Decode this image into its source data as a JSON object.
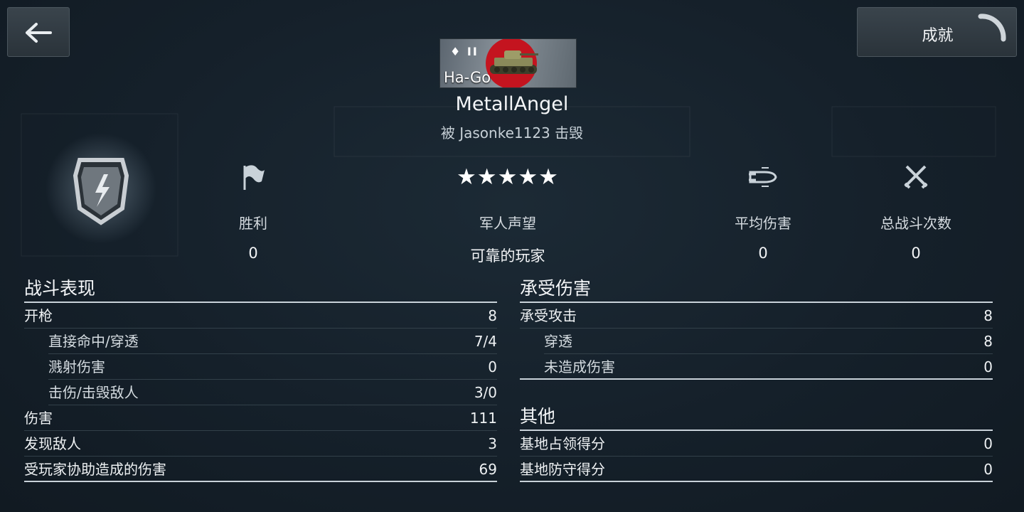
{
  "nav": {
    "back_icon": "arrow-left-icon",
    "achievements_label": "成就",
    "loading_icon": "spinner-icon"
  },
  "vehicle": {
    "tier": "♦ II",
    "name": "Ha-Go",
    "nation_color": "#c4141f"
  },
  "player": {
    "name": "MetallAngel",
    "killed_by": "被 Jasonke1123 击毁"
  },
  "stats": [
    {
      "icon": "flag-icon",
      "label": "胜利",
      "value": "0"
    },
    {
      "icon": "stars-icon",
      "stars": "★★★★★",
      "label": "军人声望",
      "value": "可靠的玩家"
    },
    {
      "icon": "shell-icon",
      "label": "平均伤害",
      "value": "0"
    },
    {
      "icon": "crossed-swords-icon",
      "label": "总战斗次数",
      "value": "0"
    }
  ],
  "combat": {
    "title": "战斗表现",
    "rows": [
      {
        "label": "开枪",
        "value": "8"
      },
      {
        "label": "直接命中/穿透",
        "value": "7/4"
      },
      {
        "label": "溅射伤害",
        "value": "0"
      },
      {
        "label": "击伤/击毁敌人",
        "value": "3/0"
      },
      {
        "label": "伤害",
        "value": "111"
      },
      {
        "label": "发现敌人",
        "value": "3"
      },
      {
        "label": "受玩家协助造成的伤害",
        "value": "69"
      }
    ]
  },
  "received": {
    "title": "承受伤害",
    "rows": [
      {
        "label": "承受攻击",
        "value": "8"
      },
      {
        "label": "穿透",
        "value": "8"
      },
      {
        "label": "未造成伤害",
        "value": "0"
      }
    ]
  },
  "other": {
    "title": "其他",
    "rows": [
      {
        "label": "基地占领得分",
        "value": "0"
      },
      {
        "label": "基地防守得分",
        "value": "0"
      }
    ]
  }
}
